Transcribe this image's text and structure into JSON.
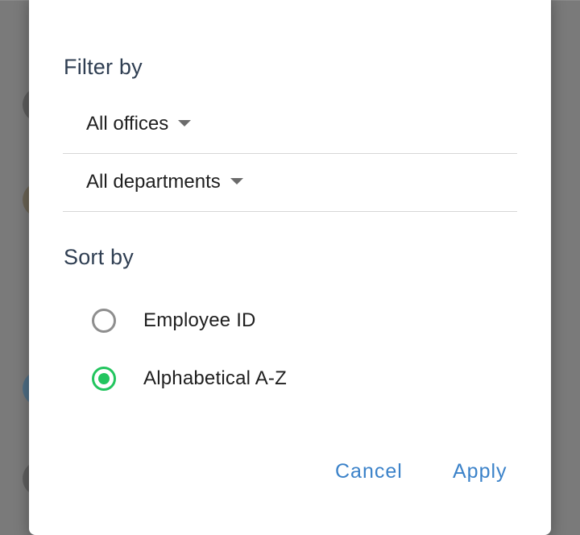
{
  "colors": {
    "accent_text": "#3b82c9",
    "radio_selected": "#22c55e",
    "heading": "#2f3e52"
  },
  "dialog": {
    "filter": {
      "title": "Filter by",
      "office_dropdown": {
        "value": "All offices",
        "icon": "caret-down-icon"
      },
      "department_dropdown": {
        "value": "All departments",
        "icon": "caret-down-icon"
      }
    },
    "sort": {
      "title": "Sort by",
      "options": [
        {
          "label": "Employee ID",
          "selected": false
        },
        {
          "label": "Alphabetical A-Z",
          "selected": true
        }
      ]
    },
    "actions": {
      "cancel_label": "Cancel",
      "apply_label": "Apply"
    }
  }
}
